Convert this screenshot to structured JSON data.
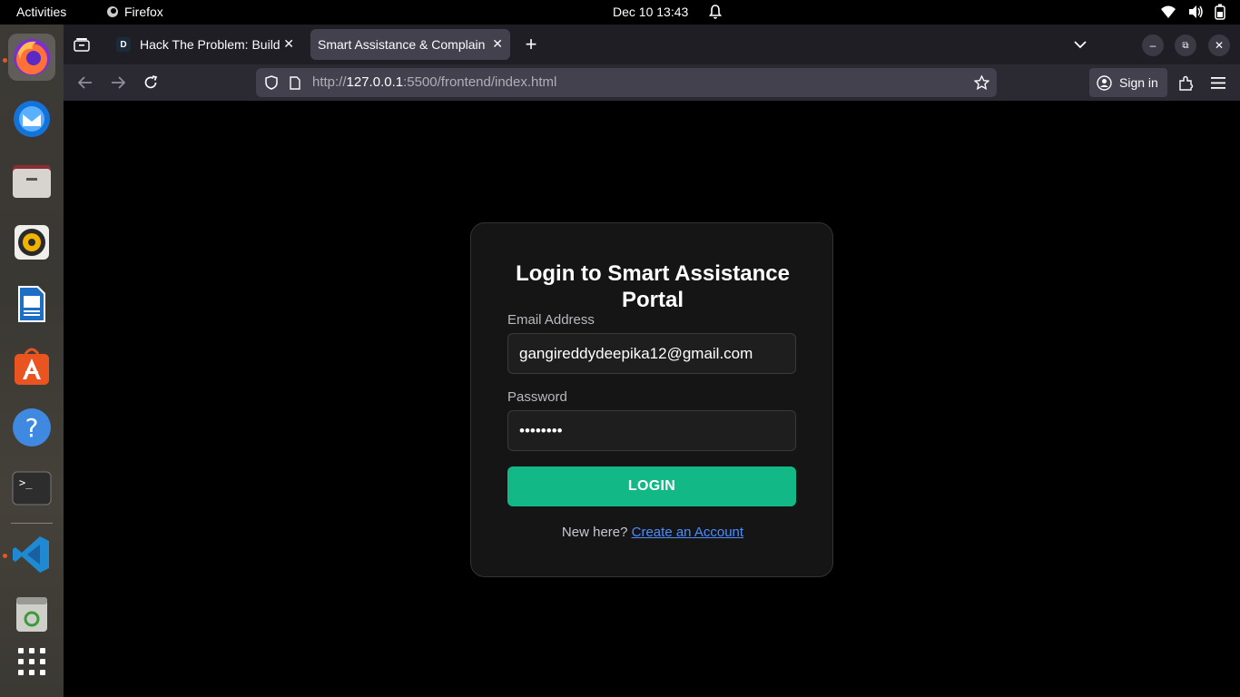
{
  "system": {
    "activities": "Activities",
    "app_name": "Firefox",
    "clock": "Dec 10  13:43"
  },
  "dock": {
    "items": [
      "Firefox",
      "Thunderbird",
      "Files",
      "Rhythmbox",
      "LibreOffice Writer",
      "Ubuntu Software",
      "Help",
      "Terminal",
      "Visual Studio Code",
      "Trash",
      "Show Applications"
    ]
  },
  "browser": {
    "tabs": [
      {
        "title": "Hack The Problem: Build",
        "favicon": "D"
      },
      {
        "title": "Smart Assistance & Complain",
        "active": true
      }
    ],
    "url": {
      "prefix": "http://",
      "host": "127.0.0.1",
      "rest": ":5500/frontend/index.html"
    },
    "signin_label": "Sign in"
  },
  "login": {
    "title": "Login to Smart Assistance Portal",
    "email_label": "Email Address",
    "email_value": "gangireddydeepika12@gmail.com",
    "password_label": "Password",
    "password_value": "deepika1",
    "button_label": "LOGIN",
    "footer_text": "New here?",
    "footer_link": "Create an Account"
  },
  "colors": {
    "accent": "#12b886",
    "link": "#4c8dff",
    "card_bg": "#151515"
  }
}
